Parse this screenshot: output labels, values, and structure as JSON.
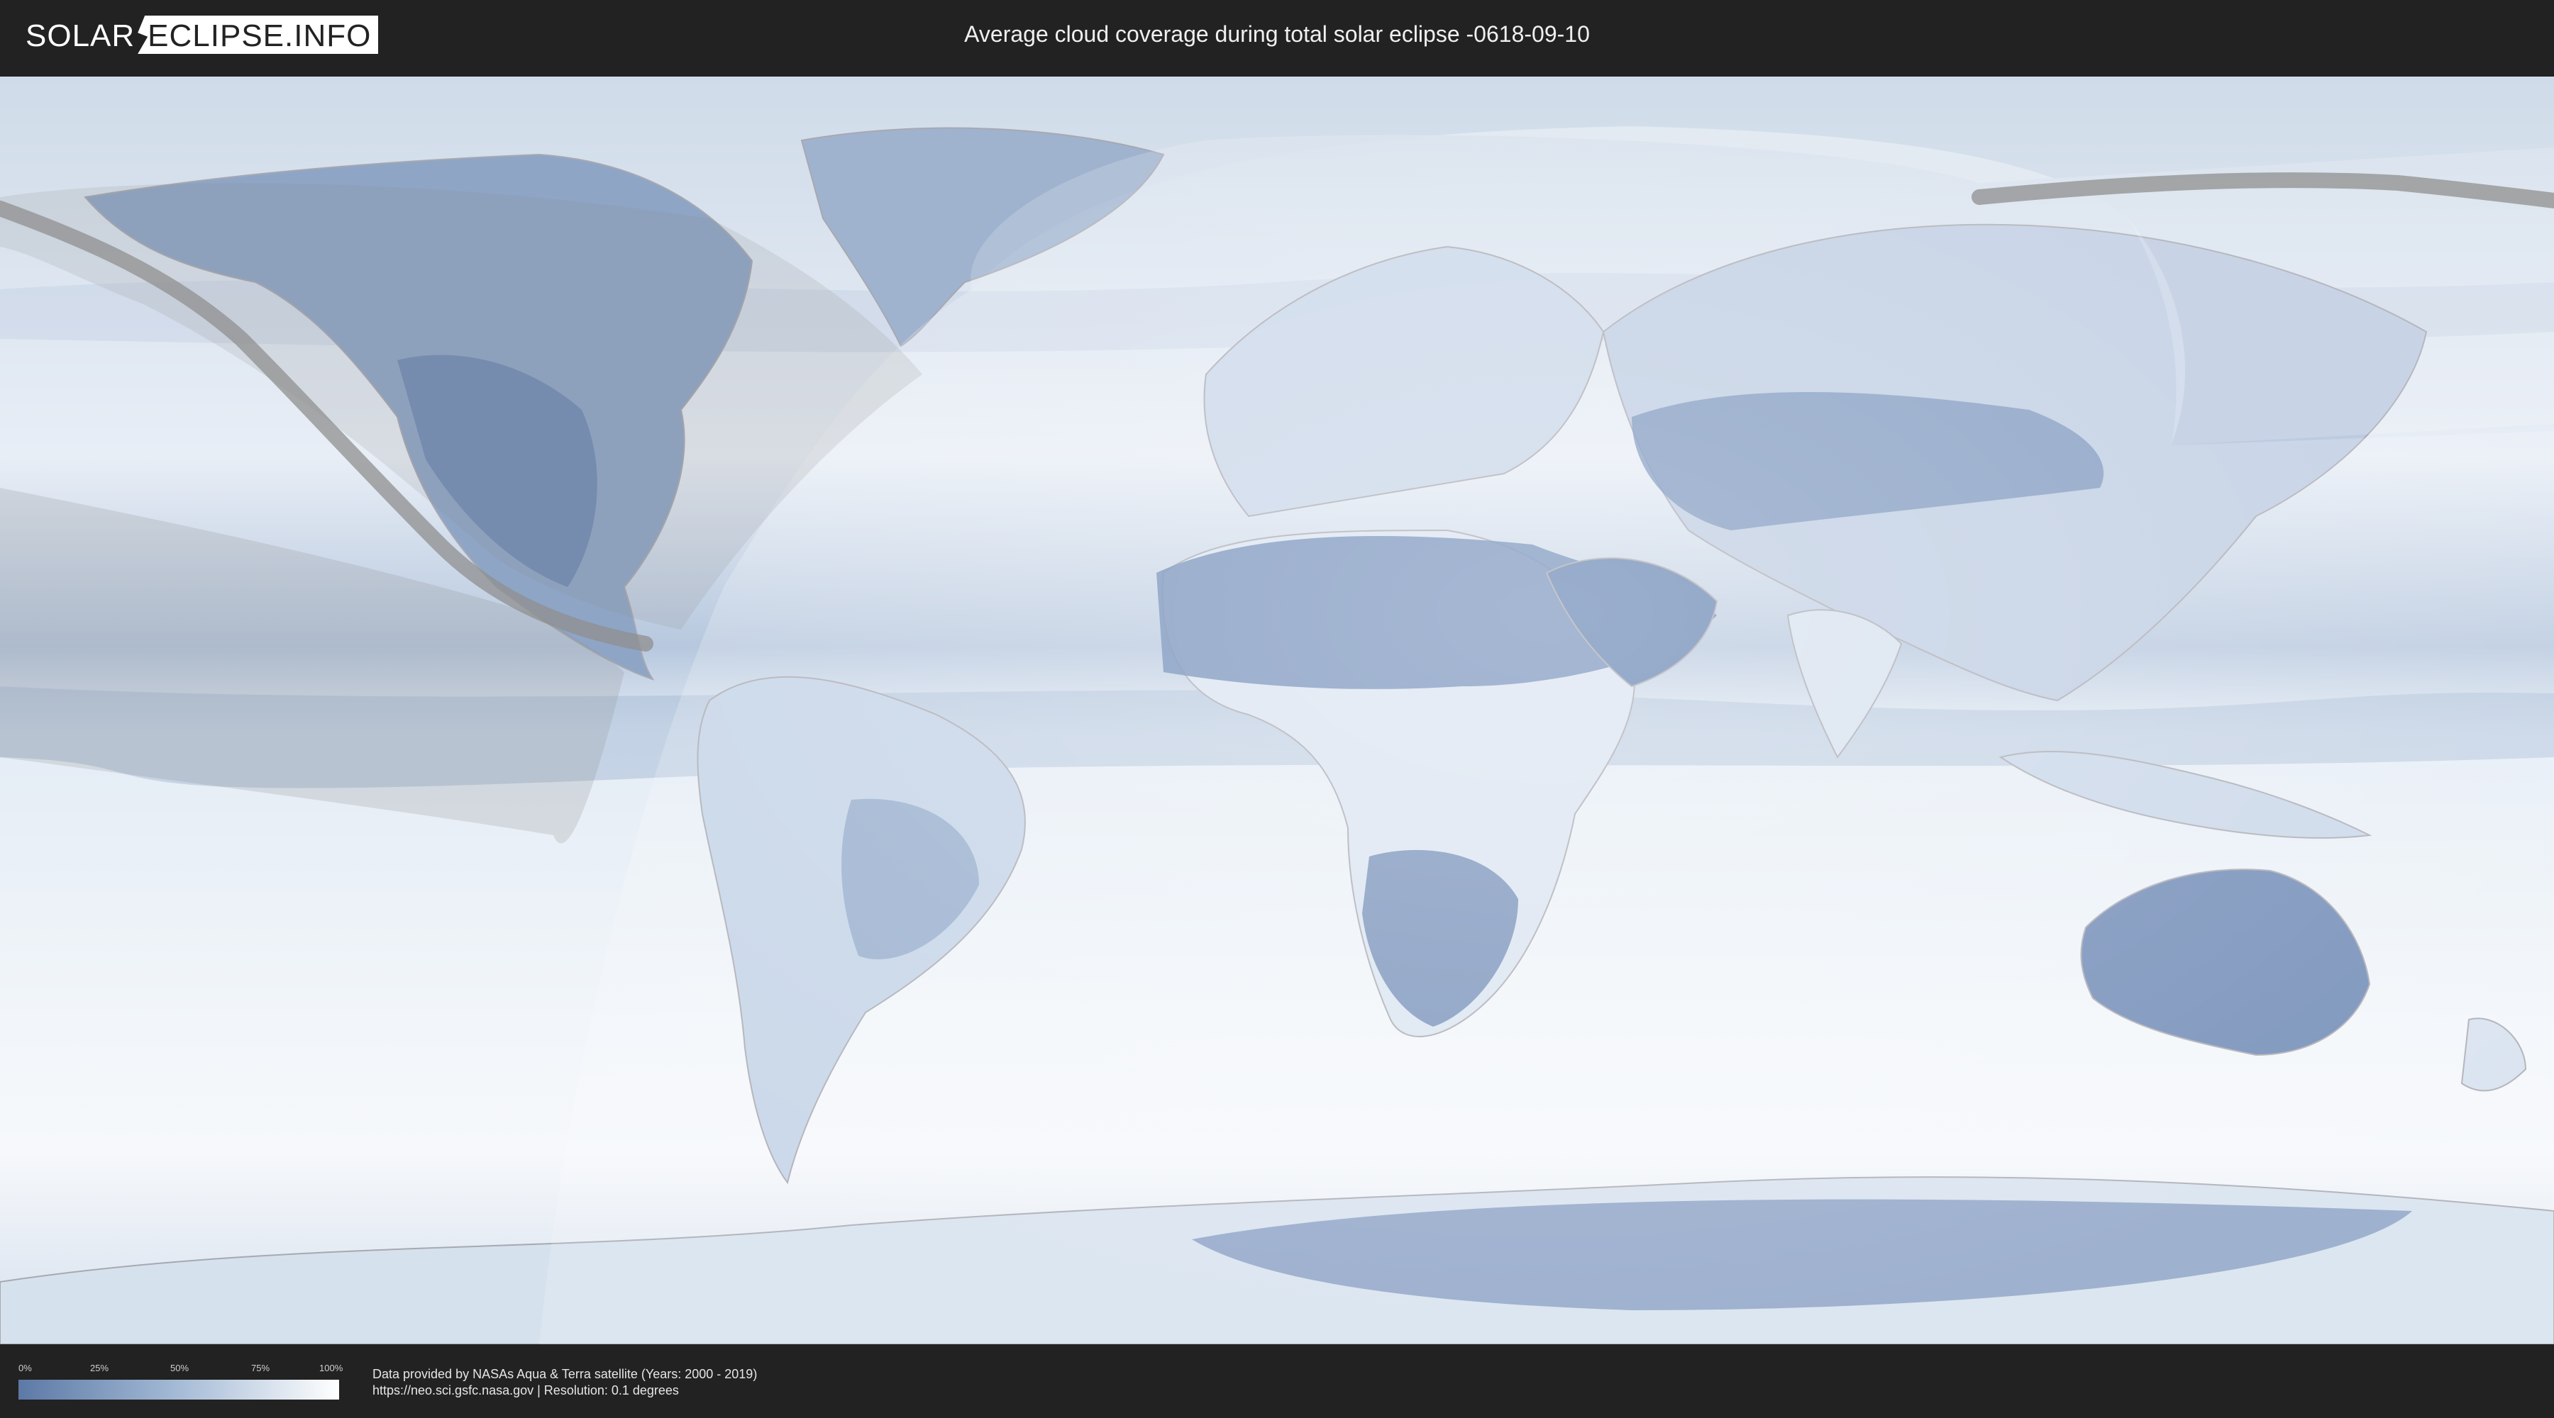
{
  "header": {
    "logo_left": "SOLAR",
    "logo_right": "ECLIPSE.INFO",
    "title": "Average cloud coverage during total solar eclipse -0618-09-10"
  },
  "legend": {
    "ticks": [
      "0%",
      "25%",
      "50%",
      "75%",
      "100%"
    ],
    "color_low": "#5c79a6",
    "color_high": "#ffffff"
  },
  "credits": {
    "line1": "Data provided by NASAs Aqua & Terra satellite (Years: 2000 - 2019)",
    "line2": "https://neo.sci.gsfc.nasa.gov | Resolution: 0.1 degrees"
  },
  "colors": {
    "background": "#222222",
    "ocean_cloud": "#dde7f2",
    "land_clear": "#5f7cab",
    "eclipse_path": "#8f8f8f"
  }
}
